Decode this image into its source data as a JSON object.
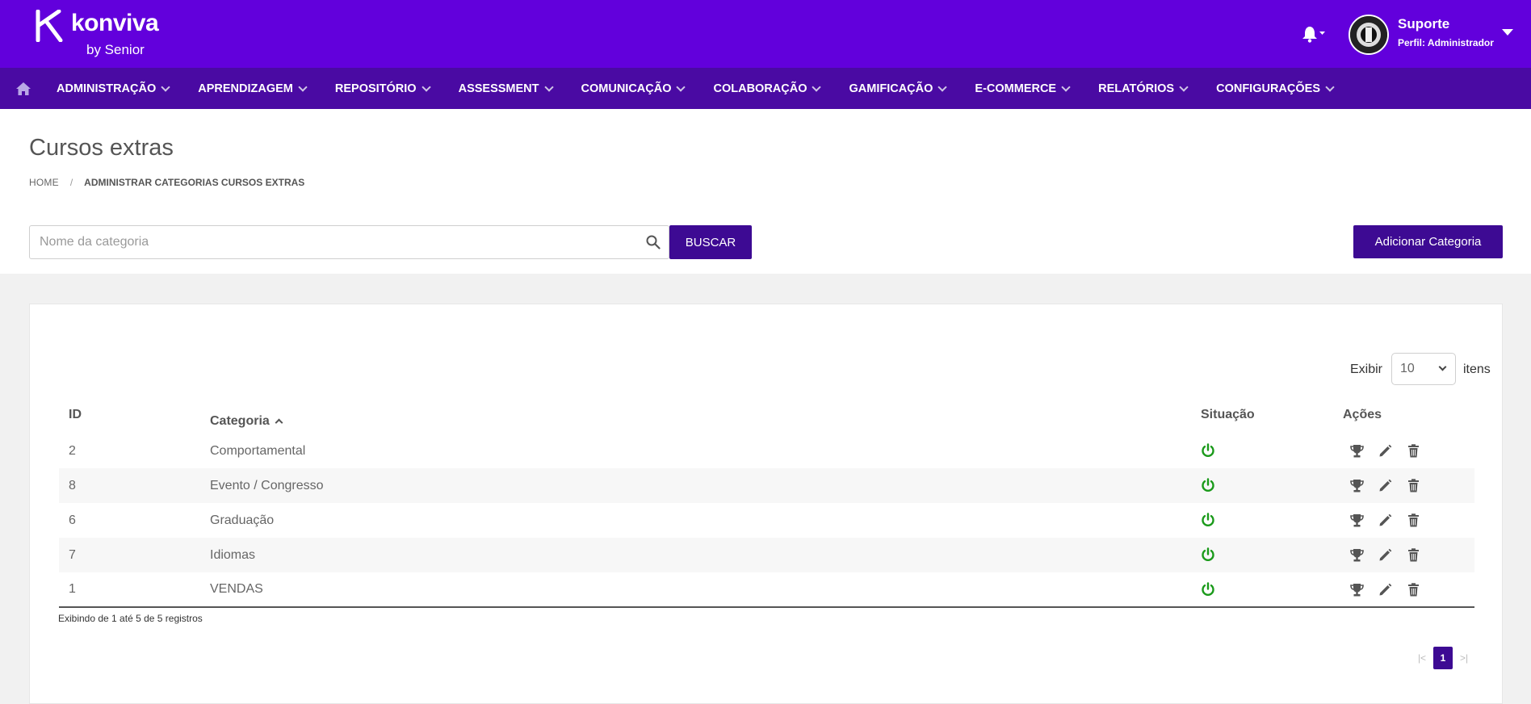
{
  "brand": {
    "name": "konviva",
    "byline": "by Senior"
  },
  "user": {
    "name": "Suporte",
    "profile": "Perfil: Administrador"
  },
  "nav": {
    "items": [
      {
        "label": "ADMINISTRAÇÃO"
      },
      {
        "label": "APRENDIZAGEM"
      },
      {
        "label": "REPOSITÓRIO"
      },
      {
        "label": "ASSESSMENT"
      },
      {
        "label": "COMUNICAÇÃO"
      },
      {
        "label": "COLABORAÇÃO"
      },
      {
        "label": "GAMIFICAÇÃO"
      },
      {
        "label": "E-COMMERCE"
      },
      {
        "label": "RELATÓRIOS"
      },
      {
        "label": "CONFIGURAÇÕES"
      }
    ]
  },
  "page": {
    "title": "Cursos extras",
    "breadcrumb": {
      "home": "HOME",
      "separator": "/",
      "current": "ADMINISTRAR CATEGORIAS CURSOS EXTRAS"
    }
  },
  "search": {
    "placeholder": "Nome da categoria",
    "value": "",
    "button": "BUSCAR"
  },
  "add_button": "Adicionar Categoria",
  "page_size": {
    "label": "Exibir",
    "value": "10",
    "suffix": "itens"
  },
  "table": {
    "headers": {
      "id": "ID",
      "category": "Categoria",
      "status": "Situação",
      "actions": "Ações"
    },
    "rows": [
      {
        "id": "2",
        "category": "Comportamental",
        "status": "active"
      },
      {
        "id": "8",
        "category": "Evento / Congresso",
        "status": "active"
      },
      {
        "id": "6",
        "category": "Graduação",
        "status": "active"
      },
      {
        "id": "7",
        "category": "Idiomas",
        "status": "active"
      },
      {
        "id": "1",
        "category": "VENDAS",
        "status": "active"
      }
    ]
  },
  "records_info": "Exibindo de 1 até 5 de 5 registros",
  "pagination": {
    "first": "|<",
    "current": "1",
    "last": ">|"
  },
  "colors": {
    "header": "#6200dc",
    "nav": "#4a0aa3",
    "button": "#3d0a93",
    "status_active": "#1a9a1a"
  },
  "icons": [
    "home-icon",
    "bell-icon",
    "search-icon",
    "power-icon",
    "trophy-icon",
    "pencil-icon",
    "trash-icon"
  ]
}
